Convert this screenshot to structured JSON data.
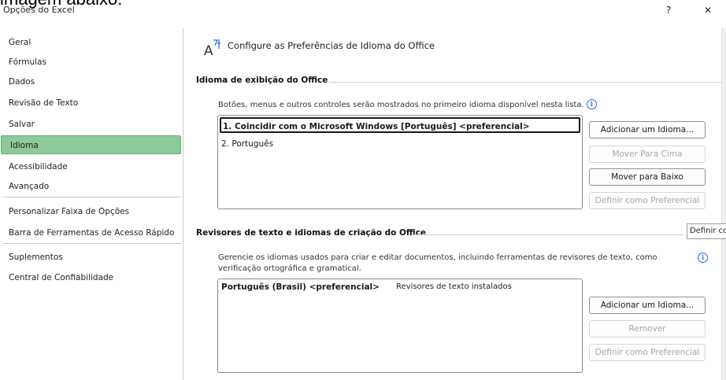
{
  "caption": "imagem abaixo:",
  "window": {
    "title": "Opções do Excel",
    "help_label": "?",
    "close_label": "✕"
  },
  "sidebar": {
    "items": [
      {
        "label": "Geral"
      },
      {
        "label": "Fórmulas"
      },
      {
        "label": "Dados"
      },
      {
        "label": "Revisão de Texto"
      },
      {
        "label": "Salvar"
      },
      {
        "label": "Idioma",
        "selected": true
      },
      {
        "label": "Acessibilidade"
      },
      {
        "label": "Avançado"
      },
      {
        "label": "Personalizar Faixa de Opções"
      },
      {
        "label": "Barra de Ferramentas de Acesso Rápido"
      },
      {
        "label": "Suplementos"
      },
      {
        "label": "Central de Confiabilidade"
      }
    ]
  },
  "header": {
    "title": "Configure as Preferências de Idioma do Office",
    "icon": "language-icon"
  },
  "display_section": {
    "title": "Idioma de exibição do Office",
    "description": "Botões, menus e outros controles serão mostrados no primeiro idioma disponível nesta lista.",
    "languages": [
      {
        "label": "1.   Coincidir com o Microsoft Windows [Português] <preferencial>",
        "selected": true
      },
      {
        "label": "2.   Português",
        "selected": false
      }
    ],
    "buttons": {
      "add": "Adicionar um Idioma...",
      "move_up": "Mover Para Cima",
      "move_down": "Mover para Baixo",
      "set_preferred": "Definir como Preferencial"
    }
  },
  "tooltip": {
    "text": "Definir como Preferencial"
  },
  "proofing_section": {
    "title": "Revisores de texto e idiomas de criação do Office",
    "description": "Gerencie os idiomas usados para criar e editar documentos, incluindo ferramentas de revisores de texto, como verificação ortográfica e gramatical.",
    "rows": [
      {
        "language": "Português (Brasil) <preferencial>",
        "status": "Revisores de texto instalados"
      }
    ],
    "buttons": {
      "add": "Adicionar um Idioma...",
      "remove": "Remover",
      "set_preferred": "Definir como Preferencial"
    }
  },
  "colors": {
    "selected_nav": "#8ec99a",
    "info": "#2a6fdb"
  }
}
